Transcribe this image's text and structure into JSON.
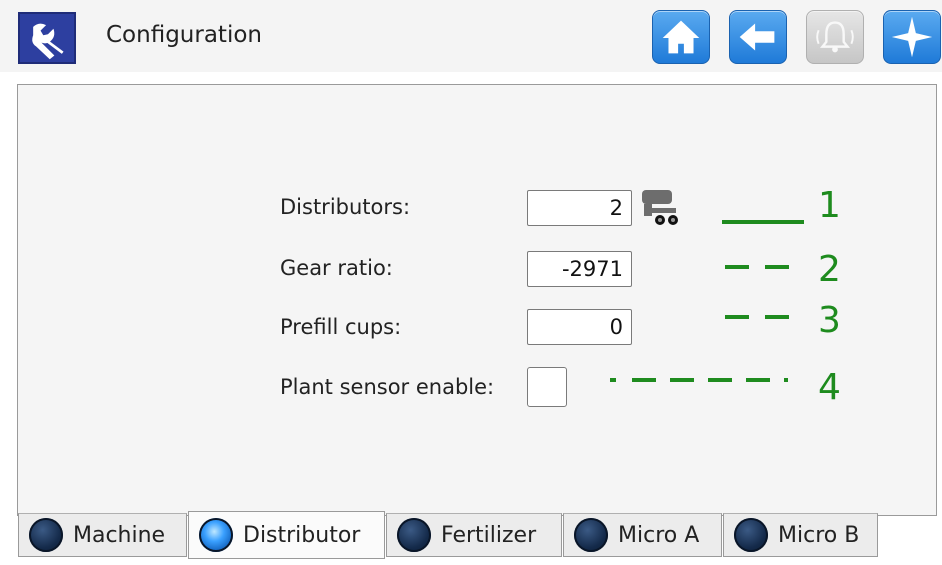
{
  "header": {
    "title": "Configuration",
    "buttons": [
      {
        "name": "home",
        "icon": "home-icon",
        "enabled": true
      },
      {
        "name": "back",
        "icon": "back-arrow-icon",
        "enabled": true
      },
      {
        "name": "alarm",
        "icon": "bell-icon",
        "enabled": false
      },
      {
        "name": "navigation",
        "icon": "compass-star-icon",
        "enabled": true
      }
    ],
    "app_icon": "wrench-icon"
  },
  "form": {
    "distributors": {
      "label": "Distributors:",
      "value": "2",
      "icon": "planter-machine-icon"
    },
    "gear_ratio": {
      "label": "Gear ratio:",
      "value": "-2971"
    },
    "prefill_cups": {
      "label": "Prefill cups:",
      "value": "0"
    },
    "plant_sensor": {
      "label": "Plant sensor enable:",
      "checked": false
    }
  },
  "legend": [
    {
      "number": "1",
      "style": "solid"
    },
    {
      "number": "2",
      "style": "dashed"
    },
    {
      "number": "3",
      "style": "dashed"
    },
    {
      "number": "4",
      "style": "dash-dot"
    }
  ],
  "tabs": [
    {
      "label": "Machine",
      "active": false
    },
    {
      "label": "Distributor",
      "active": true
    },
    {
      "label": "Fertilizer",
      "active": false
    },
    {
      "label": "Micro A",
      "active": false
    },
    {
      "label": "Micro B",
      "active": false
    }
  ],
  "colors": {
    "accent_blue": "#1f7ad8",
    "legend_green": "#1e8b1e",
    "app_icon_bg": "#2d3fa0"
  }
}
